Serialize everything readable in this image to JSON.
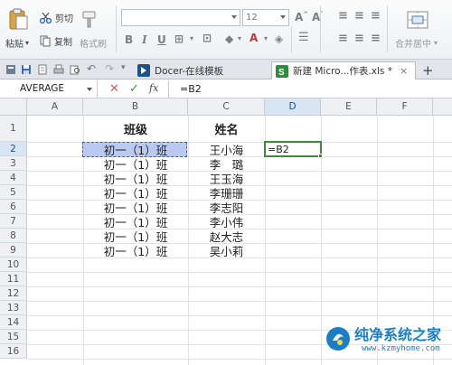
{
  "ribbon": {
    "cut_label": "剪切",
    "copy_label": "复制",
    "format_painter_label": "格式刷",
    "paste_label": "粘贴",
    "font_name": "",
    "font_size": "12",
    "bold_glyph": "B",
    "italic_glyph": "I",
    "underline_glyph": "U",
    "merge_center_label": "合并居中"
  },
  "tabs": [
    {
      "label": "Docer-在线模板",
      "active": false
    },
    {
      "label": "新建 Micro...作表.xls *",
      "active": true
    }
  ],
  "formula_bar": {
    "name_box": "AVERAGE",
    "fx_label": "fx",
    "formula": "=B2"
  },
  "columns": [
    "A",
    "B",
    "C",
    "D",
    "E",
    "F"
  ],
  "rows": [
    "1",
    "2",
    "3",
    "4",
    "5",
    "6",
    "7",
    "8",
    "9",
    "10",
    "11",
    "12",
    "13",
    "14",
    "15",
    "16"
  ],
  "sheet": {
    "header_b": "班级",
    "header_c": "姓名",
    "class_values": [
      "初一（1）班",
      "初一（1）班",
      "初一（1）班",
      "初一（1）班",
      "初一（1）班",
      "初一（1）班",
      "初一（1）班",
      "初一（1）班"
    ],
    "name_values": [
      "王小海",
      "李　璐",
      "王玉海",
      "李珊珊",
      "李志阳",
      "李小伟",
      "赵大志",
      "吴小莉"
    ],
    "active_cell_value": "=B2"
  },
  "colors": {
    "reference_fill": "#b9c9ef",
    "reference_border": "#3a5fbf",
    "active_border": "#3c8b3c",
    "watermark": "#1a7fc9"
  },
  "watermark": {
    "title": "纯净系统之家",
    "url": "www.kzmyhome.com"
  }
}
